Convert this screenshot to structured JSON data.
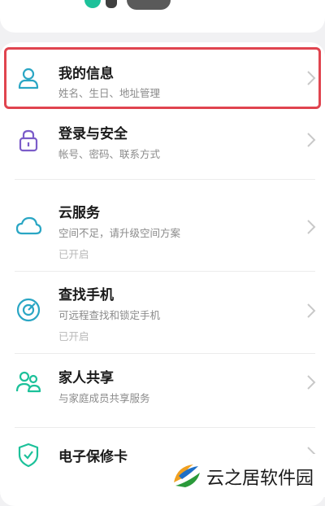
{
  "colors": {
    "accent": "#2aa6c4",
    "highlight_border": "#e0444f",
    "background": "#f1f1f3"
  },
  "menu": {
    "items": [
      {
        "icon": "person-icon",
        "title": "我的信息",
        "subtitle": "姓名、生日、地址管理",
        "status": ""
      },
      {
        "icon": "lock-icon",
        "title": "登录与安全",
        "subtitle": "帐号、密码、联系方式",
        "status": ""
      },
      {
        "icon": "cloud-icon",
        "title": "云服务",
        "subtitle": "空间不足，请升级空间方案",
        "status": "已开启"
      },
      {
        "icon": "locate-icon",
        "title": "查找手机",
        "subtitle": "可远程查找和锁定手机",
        "status": "已开启"
      },
      {
        "icon": "family-icon",
        "title": "家人共享",
        "subtitle": "与家庭成员共享服务",
        "status": ""
      },
      {
        "icon": "shield-icon",
        "title": "电子保修卡",
        "subtitle": "",
        "status": ""
      }
    ]
  },
  "watermark": {
    "text": "云之居软件园"
  }
}
